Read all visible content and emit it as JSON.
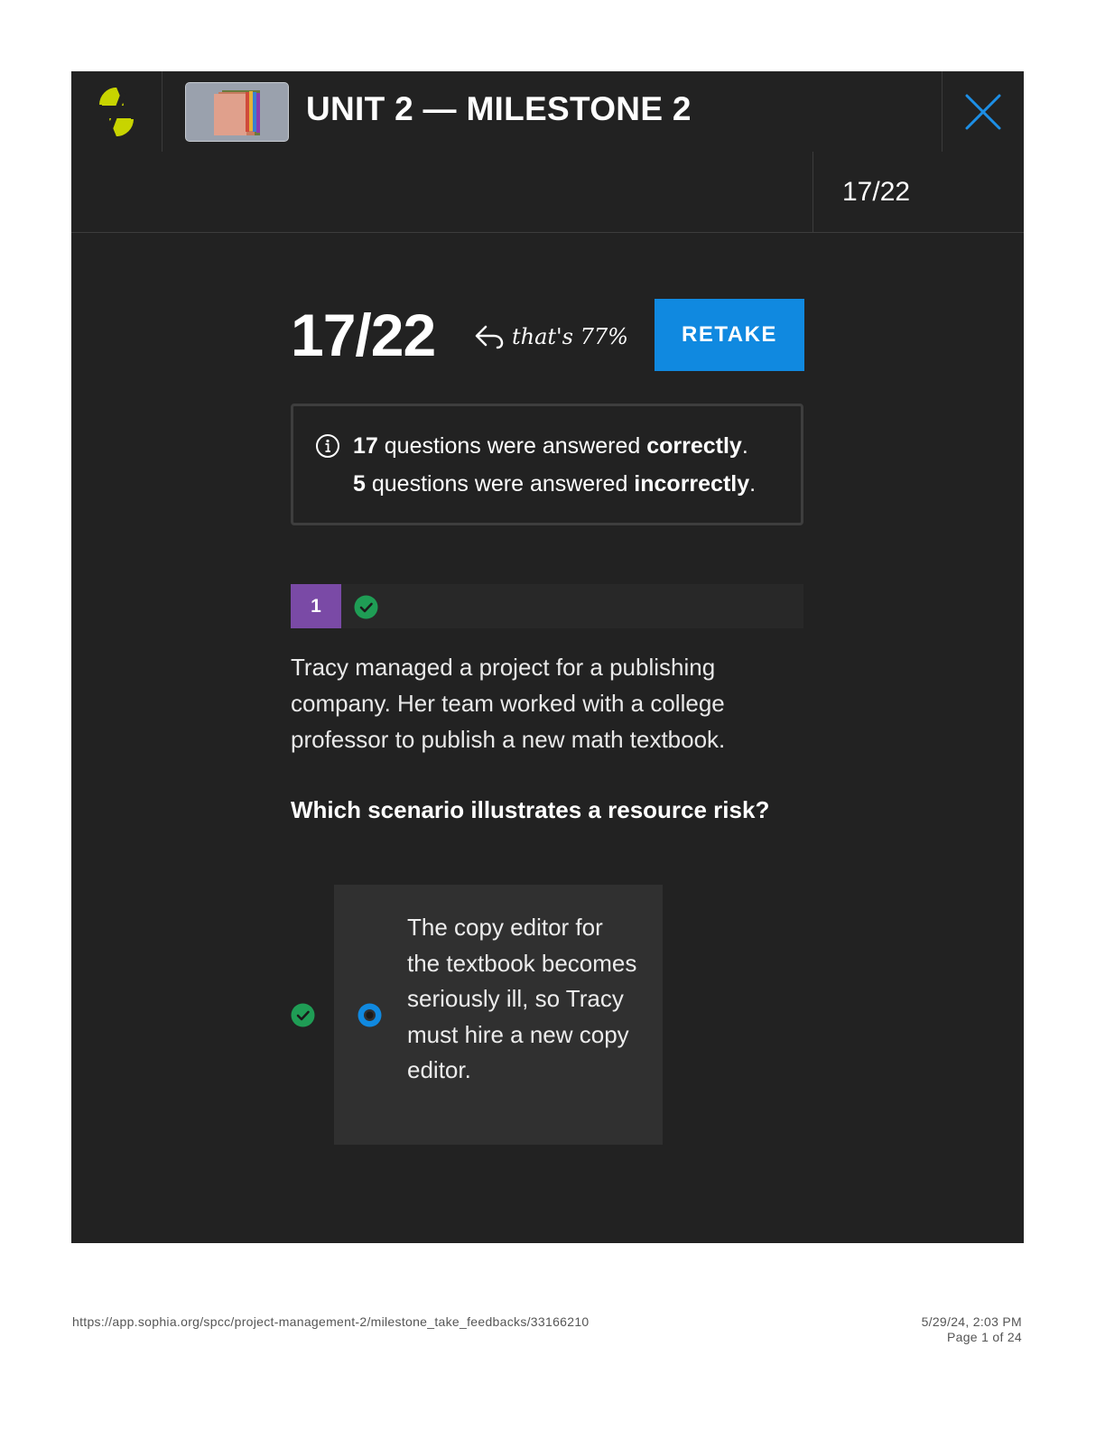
{
  "header": {
    "title": "UNIT 2 — MILESTONE 2",
    "logo_icon": "sophia-logo-icon",
    "thumbnail_icon": "course-binders-thumbnail",
    "close_icon": "close-icon"
  },
  "subheader": {
    "score": "17/22"
  },
  "results": {
    "score": "17/22",
    "percent_note": "that's 77%",
    "retake_label": "RETAKE",
    "summary": {
      "correct_count": "17",
      "correct_text": " questions were answered ",
      "correct_word": "correctly",
      "incorrect_count": "5",
      "incorrect_text": " questions were answered ",
      "incorrect_word": "incorrectly",
      "period": "."
    }
  },
  "question": {
    "number": "1",
    "status": "correct",
    "text": "Tracy managed a project for a publishing company. Her team worked with a college professor to publish a new math textbook.",
    "prompt": "Which scenario illustrates a resource risk?",
    "selected_answer": "The copy editor for the textbook becomes seriously ill, so Tracy must hire a new copy editor."
  },
  "footer": {
    "url": "https://app.sophia.org/spcc/project-management-2/milestone_take_feedbacks/33166210",
    "datetime": "5/29/24, 2:03 PM",
    "page": "Page 1 of 24"
  },
  "colors": {
    "background": "#222222",
    "accent_blue": "#1089e0",
    "purple": "#7a4aa6",
    "green": "#1f9d55",
    "logo_yellow": "#c8d400"
  }
}
